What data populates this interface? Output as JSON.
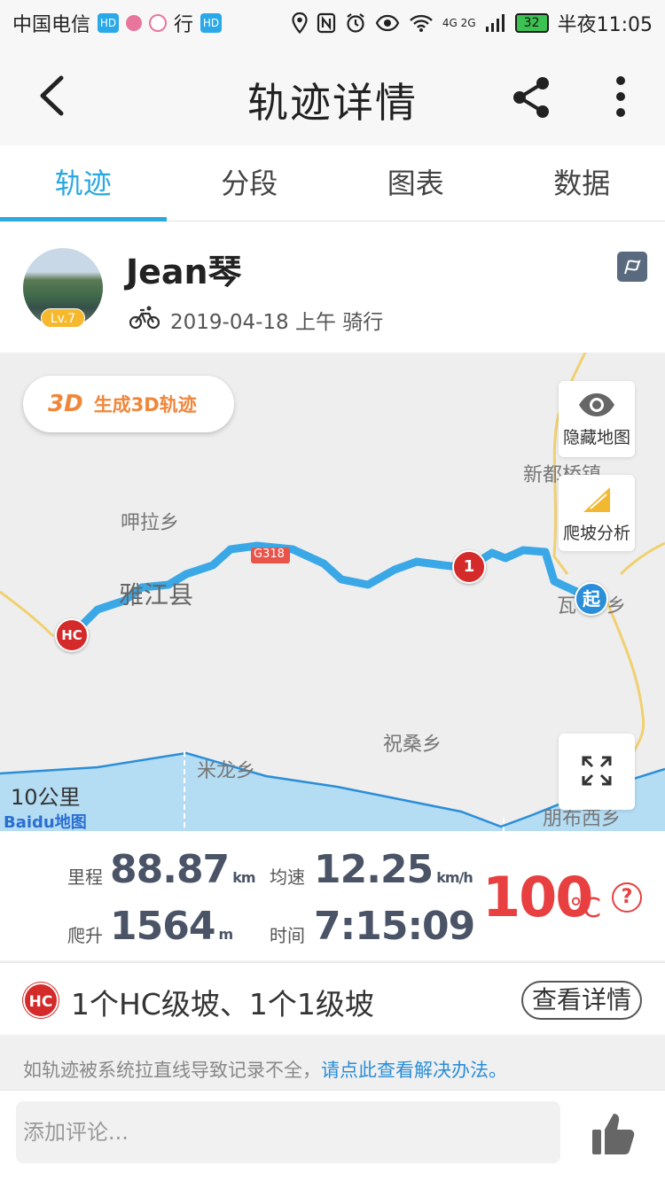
{
  "status_bar": {
    "carrier": "中国电信",
    "hd_label": "HD",
    "extra_label": "行",
    "net_label": "4G 2G",
    "battery": "32",
    "time": "半夜11:05"
  },
  "header": {
    "title": "轨迹详情"
  },
  "tabs": [
    {
      "label": "轨迹",
      "active": true
    },
    {
      "label": "分段",
      "active": false
    },
    {
      "label": "图表",
      "active": false
    },
    {
      "label": "数据",
      "active": false
    }
  ],
  "user": {
    "name": "Jean琴",
    "level": "Lv.7",
    "ride_meta": "2019-04-18 上午 骑行"
  },
  "map": {
    "btn_3d_icon": "3D",
    "btn_3d_label": "生成3D轨迹",
    "hide_map_label": "隐藏地图",
    "climb_analysis_label": "爬坡分析",
    "scale": "10公里",
    "logo": "Baidu地图",
    "places": {
      "xindu": "新都桥镇",
      "yala": "呷拉乡",
      "yajiang": "雅江县",
      "wa": "瓦",
      "wa_suffix": "乡",
      "zhusang": "祝桑乡",
      "milong": "米龙乡",
      "pengbu": "朋布西乡",
      "road": "G318"
    },
    "markers": {
      "hc": "HC",
      "one": "1",
      "start": "起"
    }
  },
  "stats": {
    "distance_label": "里程",
    "distance_value": "88.87",
    "distance_unit": "km",
    "speed_label": "均速",
    "speed_value": "12.25",
    "speed_unit": "km/h",
    "climb_label": "爬升",
    "climb_value": "1564",
    "climb_unit": "m",
    "time_label": "时间",
    "time_value": "7:15:09",
    "temperature": "100",
    "temp_unit": "°C",
    "help": "?"
  },
  "climb_summary": {
    "badge": "HC",
    "text": "1个HC级坡、1个1级坡",
    "detail_button": "查看详情"
  },
  "notice": {
    "text": "如轨迹被系统拉直线导致记录不全，",
    "link": "请点此查看解决办法。"
  },
  "comment": {
    "placeholder": "添加评论..."
  },
  "colors": {
    "accent": "#2aa8e0",
    "route": "#3aa8e6",
    "hc_red": "#d42a2a",
    "temp_red": "#e84040"
  }
}
